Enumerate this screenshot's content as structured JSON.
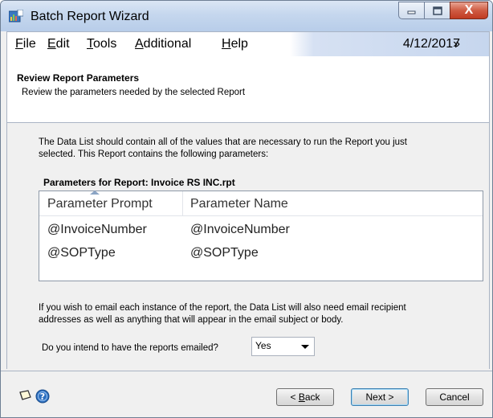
{
  "window": {
    "title": "Batch Report Wizard"
  },
  "titlebar_buttons": {
    "close_symbol": "X"
  },
  "menu": {
    "items": [
      {
        "label_first": "F",
        "label_rest": "ile"
      },
      {
        "label_first": "E",
        "label_rest": "dit"
      },
      {
        "label_first": "T",
        "label_rest": "ools"
      },
      {
        "label_first": "A",
        "label_rest": "dditional"
      },
      {
        "label_first": "H",
        "label_rest": "elp"
      }
    ],
    "date": "4/12/2017",
    "overflow_glyph": "»"
  },
  "header": {
    "title": "Review Report Parameters",
    "subtitle": "Review the parameters needed by the selected Report"
  },
  "content": {
    "intro_line1": "The Data List should contain all of the values that are necessary to run the Report you just",
    "intro_line2": "selected.  This Report contains the following parameters:",
    "params_label": "Parameters for Report: Invoice RS INC.rpt",
    "grid": {
      "columns": [
        "Parameter Prompt",
        "Parameter Name"
      ],
      "rows": [
        [
          "@InvoiceNumber",
          "@InvoiceNumber"
        ],
        [
          "@SOPType",
          "@SOPType"
        ]
      ]
    },
    "email_line1": "If you wish to email each instance of the report, the Data List will also need email recipient",
    "email_line2": "addresses as well as anything that will appear in the email subject or body.",
    "question": "Do you intend to have the reports emailed?",
    "answer": "Yes"
  },
  "footer": {
    "back_first": "< ",
    "back_ul": "B",
    "back_rest": "ack",
    "next": "Next >",
    "cancel": "Cancel"
  },
  "icons": {
    "app": "batch-report-icon",
    "note": "note-icon",
    "help": "help-icon",
    "minimize": "minimize-icon",
    "maximize": "maximize-icon",
    "close": "close-icon",
    "dropdown": "chevron-down-icon"
  }
}
